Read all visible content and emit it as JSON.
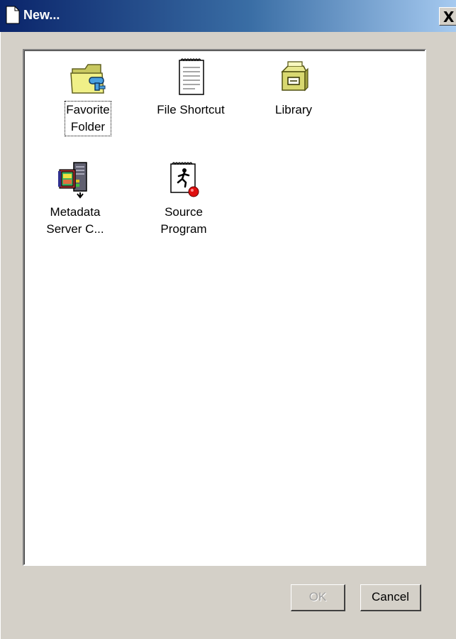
{
  "window": {
    "title": "New...",
    "close_label": "X"
  },
  "items": [
    {
      "label": "Favorite\nFolder",
      "icon": "favorite-folder-icon",
      "selected": true
    },
    {
      "label": "File Shortcut",
      "icon": "file-shortcut-icon",
      "selected": false
    },
    {
      "label": "Library",
      "icon": "library-icon",
      "selected": false
    },
    {
      "label": "Metadata\nServer C...",
      "icon": "metadata-server-icon",
      "selected": false
    },
    {
      "label": "Source\nProgram",
      "icon": "source-program-icon",
      "selected": false
    }
  ],
  "buttons": {
    "ok": "OK",
    "cancel": "Cancel"
  },
  "colors": {
    "titlebar_start": "#0a246a",
    "titlebar_end": "#a6caf0",
    "face": "#d4d0c8"
  }
}
